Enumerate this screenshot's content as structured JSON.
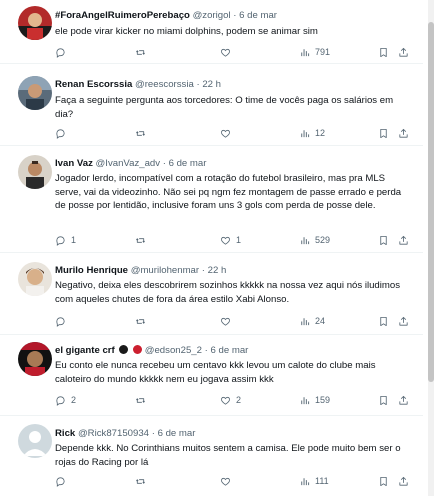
{
  "tweets": [
    {
      "name": "#ForaAngelRuimeroPerebaço",
      "handle": "@zorigol",
      "dot": "·",
      "time": "6 de mar",
      "text": "ele pode virar kicker no miami dolphins, podem se animar sim",
      "replies": "",
      "retweets": "",
      "likes": "",
      "views": "791"
    },
    {
      "name": "Renan Escorssia",
      "handle": "@reescorssia",
      "dot": "·",
      "time": "22 h",
      "text": "Faça a seguinte pergunta aos torcedores: O time de vocês paga os salários em dia?",
      "replies": "",
      "retweets": "",
      "likes": "",
      "views": "12"
    },
    {
      "name": "Ivan Vaz",
      "handle": "@IvanVaz_adv",
      "dot": "·",
      "time": "6 de mar",
      "text": "Jogador lerdo, incompatível com a rotação do futebol brasileiro, mas pra MLS serve, vai da videozinho. Não sei pq ngm fez montagem de passe errado e perda de posse por lentidão, inclusive foram uns 3 gols com perda de posse dele.",
      "replies": "1",
      "retweets": "",
      "likes": "1",
      "views": "529"
    },
    {
      "name": "Murilo Henrique",
      "handle": "@murilohenmar",
      "dot": "·",
      "time": "22 h",
      "text": "Negativo, deixa eles descobrirem sozinhos kkkkk na nossa vez aqui nós iludimos com aqueles chutes de fora da área estilo Xabi Alonso.",
      "replies": "",
      "retweets": "",
      "likes": "",
      "views": "24"
    },
    {
      "name": "el gigante crf",
      "handle": "@edson25_2",
      "dot": "·",
      "time": "6 de mar",
      "text": "Eu conto ele nunca recebeu um centavo kkk levou um calote do clube mais caloteiro do mundo kkkkk nem eu jogava assim kkk",
      "replies": "2",
      "retweets": "",
      "likes": "2",
      "views": "159"
    },
    {
      "name": "Rick",
      "handle": "@Rick87150934",
      "dot": "·",
      "time": "6 de mar",
      "text": "Depende kkk. No Corinthians muitos sentem a camisa. Ele pode muito bem ser o rojas do Racing por lá",
      "replies": "",
      "retweets": "",
      "likes": "",
      "views": "111"
    }
  ],
  "icons": {
    "reply": "reply-icon",
    "retweet": "retweet-icon",
    "like": "heart-icon",
    "views": "views-icon",
    "bookmark": "bookmark-icon",
    "share": "share-icon"
  },
  "colors": {
    "text": "#0f1419",
    "secondary": "#536471",
    "divider": "#eff3f4",
    "badge_dark": "#1a1a1a",
    "badge_red": "#cc1f2f"
  }
}
